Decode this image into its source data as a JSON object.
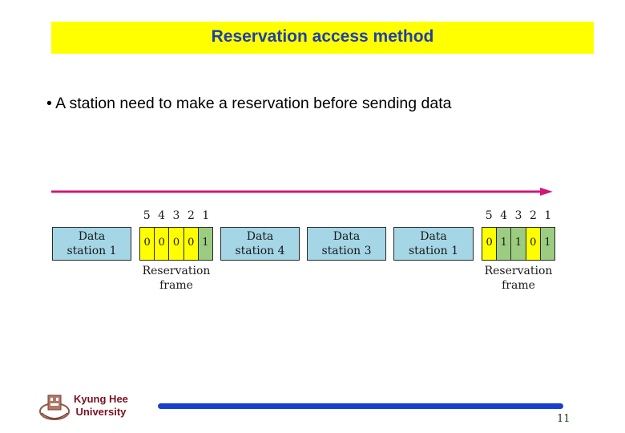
{
  "slide": {
    "title": "Reservation access method",
    "bullet": "• A station need to make a reservation before sending data",
    "page_number": "11"
  },
  "footer": {
    "university_line1": "Kyung Hee",
    "university_line2": "University"
  },
  "diagram": {
    "arrow_color": "#d0187a",
    "title_color": "#1f3fae",
    "title_bg": "#ffff00",
    "bit_colors": {
      "zero": "#ffff00",
      "one": "#9ccc80"
    },
    "data_box_color": "#a4d6e6",
    "bit_numbers": [
      "5",
      "4",
      "3",
      "2",
      "1"
    ],
    "frame1": {
      "bits": [
        "0",
        "0",
        "0",
        "0",
        "1"
      ],
      "caption_line1": "Reservation",
      "caption_line2": "frame"
    },
    "frame2": {
      "bits": [
        "0",
        "1",
        "1",
        "0",
        "1"
      ],
      "caption_line1": "Reservation",
      "caption_line2": "frame"
    },
    "data_boxes": [
      {
        "line1": "Data",
        "line2": "station 1"
      },
      {
        "line1": "Data",
        "line2": "station 4"
      },
      {
        "line1": "Data",
        "line2": "station 3"
      },
      {
        "line1": "Data",
        "line2": "station 1"
      }
    ]
  }
}
